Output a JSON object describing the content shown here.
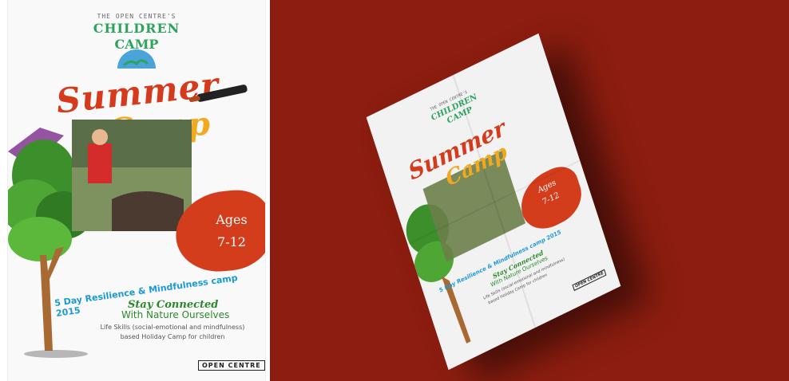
{
  "colors": {
    "background_right": "#8c1d10",
    "title_red": "#d53a1c",
    "title_yellow": "#f2a91f",
    "headline_blue": "#1b9ad6",
    "tagline_green": "#2a8a2a",
    "logo_green": "#2ea35b"
  },
  "poster": {
    "logo_line1": "THE OPEN CENTRE'S",
    "logo_line2": "CHILDREN",
    "logo_line3": "CAMP",
    "title_line1": "Summer",
    "title_line2": "Camp",
    "ages_label": "Ages",
    "ages_range": "7-12",
    "headline": "5 Day Resilience & Mindfulness camp 2015",
    "tagline1": "Stay Connected",
    "tagline2": "With Nature Ourselves",
    "description1": "Life Skills (social-emotional and mindfulness)",
    "description2": "based Holiday Camp for children",
    "brand": "OPEN CENTRE"
  },
  "icons": {
    "globe": "globe-icon",
    "paintbrush": "paintbrush-icon",
    "tree": "tree-illustration"
  }
}
